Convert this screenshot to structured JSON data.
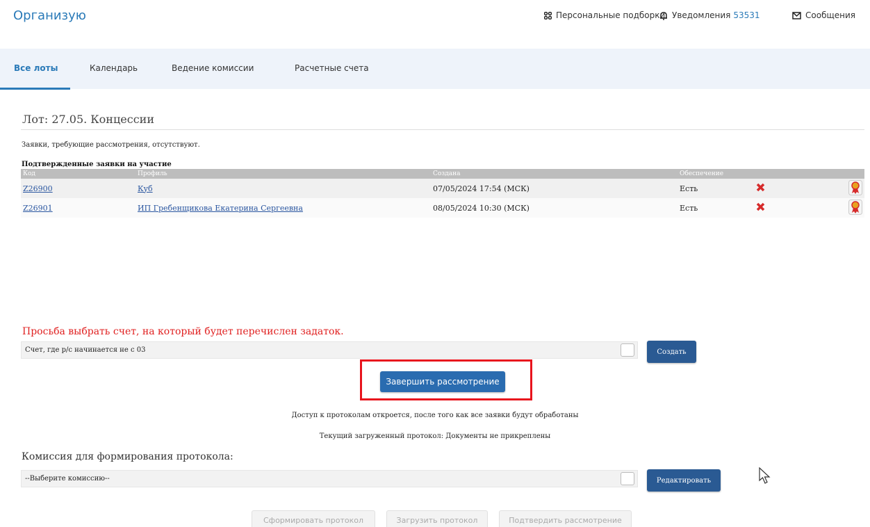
{
  "header": {
    "brand": "Организую",
    "personal": "Персональные подборки",
    "notifications_label": "Уведомления",
    "notifications_count": "53531",
    "messages": "Сообщения"
  },
  "tabs": [
    {
      "label": "Все лоты",
      "active": true
    },
    {
      "label": "Календарь"
    },
    {
      "label": "Ведение комиссии"
    },
    {
      "label": "Расчетные счета"
    }
  ],
  "lot": {
    "title": "Лот: 27.05. Концессии",
    "no_pending": "Заявки, требующие рассмотрения, отсутствуют.",
    "confirmed_heading": "Подтвержденные заявки на участие"
  },
  "table": {
    "headers": [
      "Код",
      "Профиль",
      "Создана",
      "Обеспечение"
    ],
    "rows": [
      {
        "code": "Z26900",
        "profile": "Куб",
        "created": "07/05/2024 17:54 (МСК)",
        "security": "Есть"
      },
      {
        "code": "Z26901",
        "profile": "ИП Гребенщикова Екатерина Сергеевна",
        "created": "08/05/2024 10:30 (МСК)",
        "security": "Есть"
      }
    ]
  },
  "account": {
    "prompt": "Просьба выбрать счет, на который будет перечислен задаток.",
    "selected": "Счет, где р/с начинается не с 03",
    "create_button": "Создать"
  },
  "finish_button": "Завершить рассмотрение",
  "access_note": "Доступ к протоколам откроется, после того как все заявки будут обработаны",
  "current_protocol": "Текущий загруженный протокол: Документы не прикреплены",
  "commission": {
    "label": "Комиссия для формирования протокола:",
    "selected": "--Выберите комиссию--",
    "edit_button": "Редактировать"
  },
  "bottom_buttons": {
    "form": "Сформировать протокол",
    "upload": "Загрузить протокол",
    "confirm": "Подтвердить рассмотрение"
  },
  "colors": {
    "accent": "#2a7ab8",
    "button": "#2a5a93",
    "alert": "#e02020",
    "highlight": "#e8141d"
  }
}
